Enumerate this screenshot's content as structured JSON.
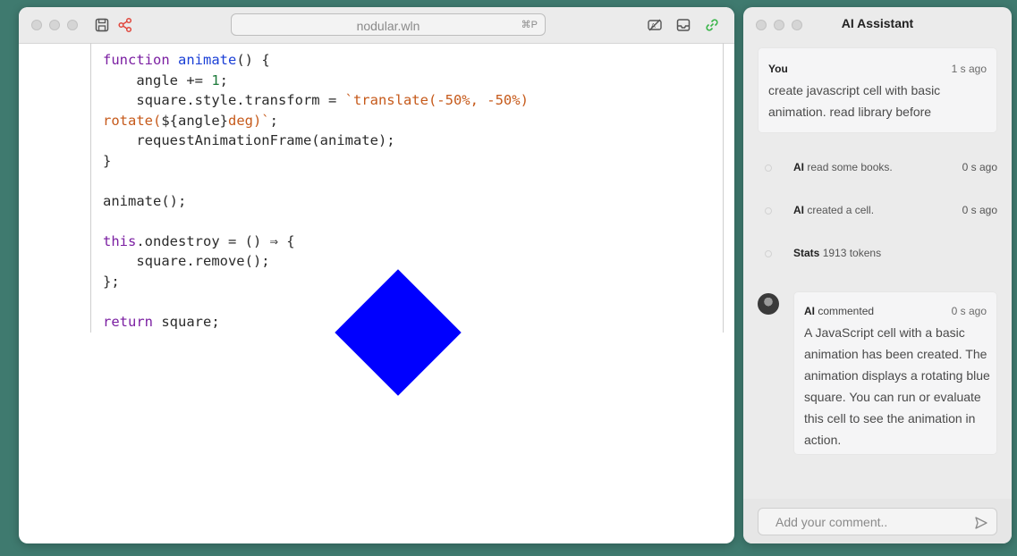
{
  "editor": {
    "address": "nodular.wln",
    "address_shortcut": "⌘P",
    "icons": [
      "save-icon",
      "share-icon",
      "translate-icon",
      "inbox-icon",
      "link-icon"
    ],
    "code_lines": [
      "function animate() {",
      "    angle += 1;",
      "    square.style.transform = `translate(-50%, -50%)",
      "rotate(${angle}deg)`;",
      "    requestAnimationFrame(animate);",
      "}",
      "",
      "animate();",
      "",
      "this.ondestroy = () ⇒ {",
      "    square.remove();",
      "};",
      "",
      "return square;"
    ],
    "output": {
      "shape_color": "#0000ff",
      "rotation_deg": 45
    }
  },
  "assistant": {
    "title": "AI Assistant",
    "user_message": {
      "author": "You",
      "time": "1 s ago",
      "text": "create javascript cell with basic animation. read library before"
    },
    "events": [
      {
        "actor": "AI",
        "action": "read some books.",
        "time": "0 s ago"
      },
      {
        "actor": "AI",
        "action": "created a cell.",
        "time": "0 s ago"
      },
      {
        "actor": "Stats",
        "action": "1913 tokens",
        "time": ""
      }
    ],
    "ai_comment": {
      "author": "AI",
      "verb": "commented",
      "time": "0 s ago",
      "text": "A JavaScript cell with a basic animation has been created. The animation displays a rotating blue square. You can run or evaluate this cell to see the animation in action."
    },
    "comment_placeholder": "Add your comment.."
  },
  "colors": {
    "background": "#3f7a6f",
    "keyword": "#7b1fa2",
    "function_name": "#1a3fd6",
    "number": "#1d7a3a",
    "string": "#c65a1b",
    "link_icon": "#3bb54a",
    "share_icon": "#e0483e"
  }
}
